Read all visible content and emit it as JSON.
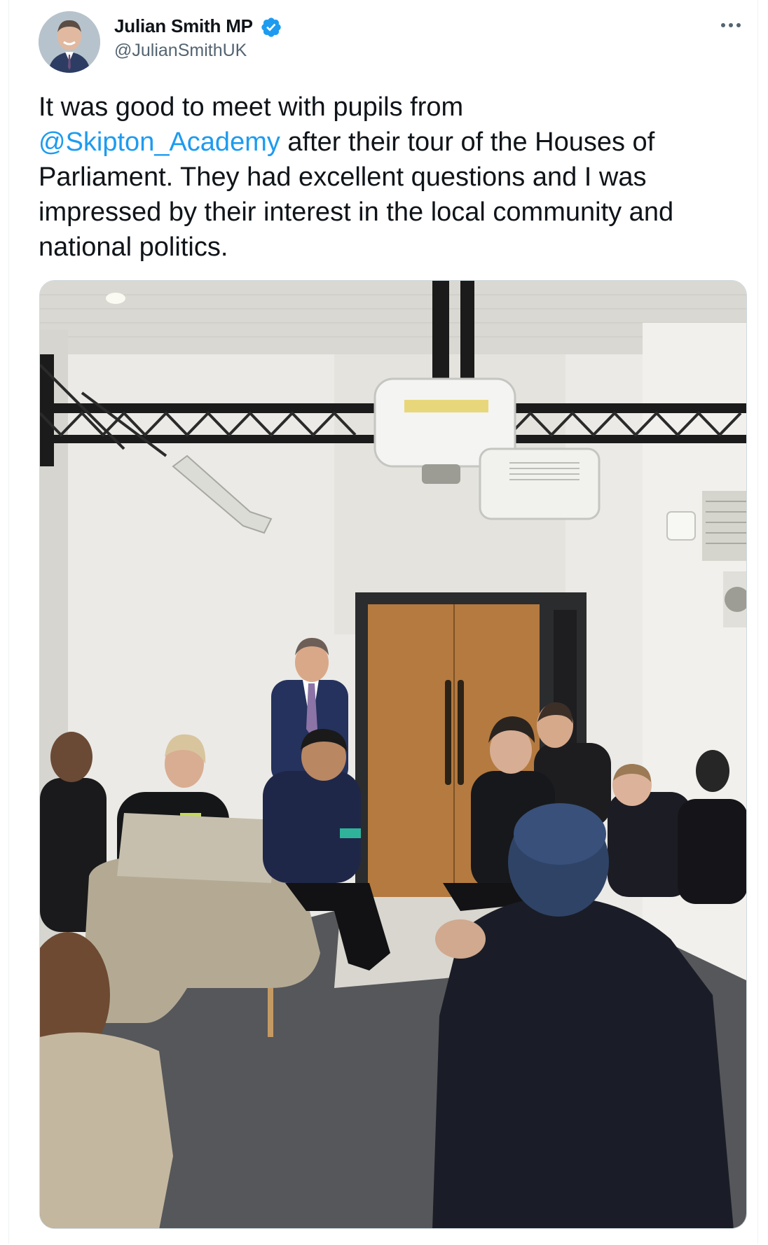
{
  "tweet": {
    "author": {
      "display_name": "Julian Smith MP",
      "handle": "@JulianSmithUK",
      "verified": true
    },
    "text": {
      "line_before": "It was good to meet with pupils from",
      "mention": "@Skipton_Academy",
      "line_after": " after their tour of the Houses of Parliament. They had excellent questions and I was impressed by their interest in the local community and national politics."
    },
    "media": {
      "type": "photo"
    }
  },
  "colors": {
    "accent": "#1d9bf0",
    "text_primary": "#0f1419",
    "text_secondary": "#536471",
    "border": "#cfd9de"
  },
  "icons": {
    "verified": "verified-badge-icon",
    "more": "more-options-icon"
  }
}
